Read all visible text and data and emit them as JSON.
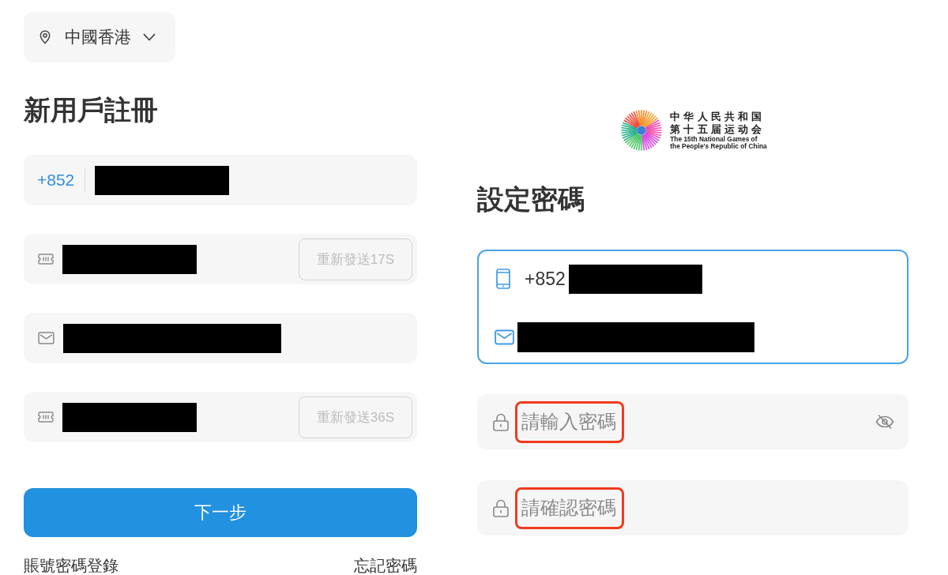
{
  "region_selector": {
    "label": "中國香港"
  },
  "left_form": {
    "title": "新用戶註冊",
    "fields": [
      {
        "kind": "phone",
        "prefix": "+852",
        "redacted": true
      },
      {
        "kind": "code",
        "redacted": true,
        "action": {
          "label": "重新發送17S",
          "disabled": true
        }
      },
      {
        "kind": "email",
        "redacted": true
      },
      {
        "kind": "code",
        "redacted": true,
        "action": {
          "label": "重新發送36S",
          "disabled": true
        }
      }
    ],
    "next_button": "下一步",
    "links": [
      "賬號密碼登錄",
      "忘記密碼"
    ]
  },
  "logo": {
    "title_lines": [
      "中华人民共和国",
      "第十五届运动会"
    ],
    "subtitle_lines": [
      "The 15th National Games of",
      "the People's Republic of China"
    ]
  },
  "right_form": {
    "title": "設定密碼",
    "account": {
      "focused": true,
      "phone_prefix": "+852",
      "phone_redacted": true,
      "email_redacted": true
    },
    "password_fields": [
      {
        "placeholder": "請輸入密碼",
        "highlighted": true,
        "visibility_toggle": true
      },
      {
        "placeholder": "請確認密碼",
        "highlighted": true,
        "visibility_toggle": false
      }
    ]
  }
}
